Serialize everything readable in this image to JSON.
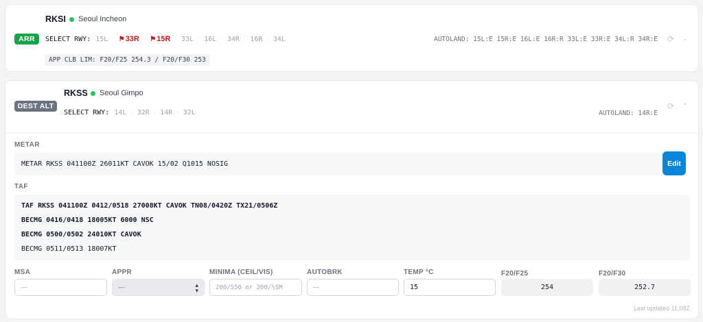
{
  "airports": [
    {
      "code": "RKSI",
      "name": "Seoul Incheon",
      "role": "ARR",
      "select_label": "SELECT RWY:",
      "runways": [
        {
          "id": "15L",
          "selected": false
        },
        {
          "id": "33R",
          "selected": true
        },
        {
          "id": "15R",
          "selected": true
        },
        {
          "id": "33L",
          "selected": false
        },
        {
          "id": "16L",
          "selected": false
        },
        {
          "id": "34R",
          "selected": false
        },
        {
          "id": "16R",
          "selected": false
        },
        {
          "id": "34L",
          "selected": false
        }
      ],
      "autoland": "AUTOLAND: 15L:E 15R:E 16L:E 16R:R 33L:E 33R:E 34L:R 34R:E",
      "climb_limit": "APP CLB LIM: F20/F25 254.3 / F20/F30 253"
    },
    {
      "code": "RKSS",
      "name": "Seoul Gimpo",
      "role": "DEST ALT",
      "select_label": "SELECT RWY:",
      "runways": [
        {
          "id": "14L",
          "selected": false
        },
        {
          "id": "32R",
          "selected": false
        },
        {
          "id": "14R",
          "selected": false
        },
        {
          "id": "32L",
          "selected": false
        }
      ],
      "autoland": "AUTOLAND: 14R:E"
    }
  ],
  "weather": {
    "metar_label": "METAR",
    "metar": "METAR RKSS 041100Z 26011KT CAVOK 15/02 Q1015 NOSIG",
    "edit_label": "Edit",
    "taf_label": "TAF",
    "taf_lines": [
      {
        "text": "TAF RKSS 041100Z 0412/0518 27008KT CAVOK TN08/0420Z TX21/0506Z",
        "bold": true
      },
      {
        "text": "BECMG 0416/0418 18005KT 6000 NSC",
        "bold": true
      },
      {
        "text": "BECMG 0500/0502 24010KT CAVOK",
        "bold": true
      },
      {
        "text": "BECMG 0511/0513 18007KT",
        "bold": false
      }
    ]
  },
  "fields": {
    "msa": {
      "label": "MSA",
      "placeholder": "—"
    },
    "appr": {
      "label": "APPR",
      "value": "—"
    },
    "minima": {
      "label": "MINIMA (CEIL/VIS)",
      "placeholder": "200/550 or 200/½SM"
    },
    "autobrk": {
      "label": "AUTOBRK",
      "placeholder": "—"
    },
    "temp": {
      "label": "TEMP °C",
      "value": "15"
    },
    "f20f25": {
      "label": "F20/F25",
      "value": "254"
    },
    "f20f30": {
      "label": "F20/F30",
      "value": "252.7"
    }
  },
  "last_updated": "Last updated 11:08Z",
  "colors": {
    "arr": "#16a34a",
    "alt": "#6b7280",
    "selected_rwy": "#b91c1c",
    "edit": "#0a84d6"
  }
}
